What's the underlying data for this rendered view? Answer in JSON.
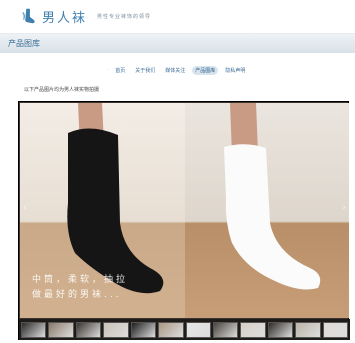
{
  "header": {
    "brand": "男人袜",
    "slogan": "男性专业袜饰的领导",
    "logo_icon": "sock-logo-icon"
  },
  "titlebar": {
    "title": "产品图库"
  },
  "nav": {
    "items": [
      {
        "label": "首页",
        "active": false
      },
      {
        "label": "关于我们",
        "active": false
      },
      {
        "label": "媒体关注",
        "active": false
      },
      {
        "label": "产品图库",
        "active": true
      },
      {
        "label": "隐私声明",
        "active": false
      }
    ]
  },
  "notice": "以下产品图片均为男人袜实物拍摄",
  "viewer": {
    "caption_line1": "中筒，柔软，抽拉",
    "caption_line2": "做最好的男袜...",
    "thumb_count": 12
  }
}
